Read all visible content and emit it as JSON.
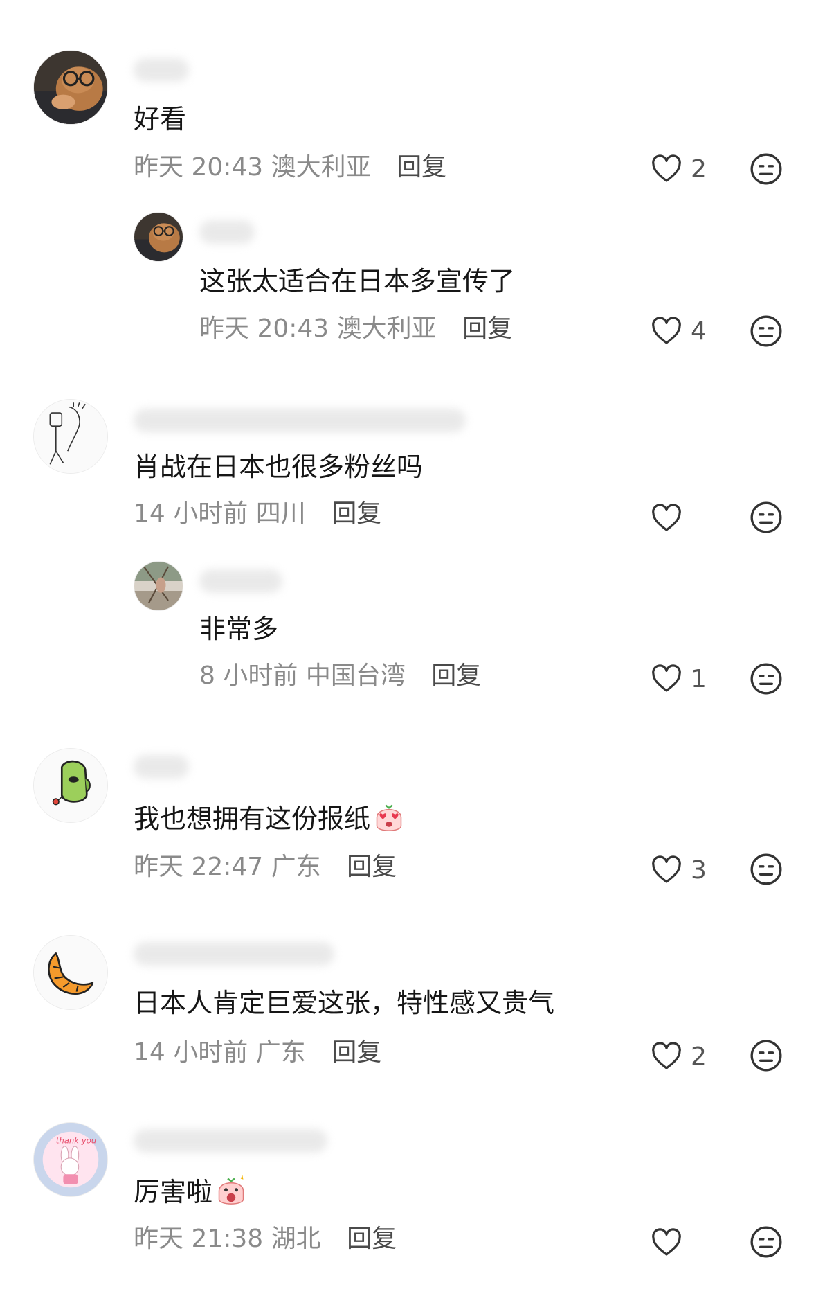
{
  "comments": [
    {
      "text": "好看",
      "time": "昨天 20:43",
      "location": "澳大利亚",
      "reply": "回复",
      "likes": "2",
      "avatar_icon": "cat-with-glasses-icon"
    },
    {
      "text": "这张太适合在日本多宣传了",
      "time": "昨天 20:43",
      "location": "澳大利亚",
      "reply": "回复",
      "likes": "4",
      "avatar_icon": "cat-with-glasses-icon"
    },
    {
      "text": "肖战在日本也很多粉丝吗",
      "time": "14 小时前",
      "location": "四川",
      "reply": "回复",
      "likes": "",
      "avatar_icon": "sketch-figure-icon"
    },
    {
      "text": "非常多",
      "time": "8 小时前",
      "location": "中国台湾",
      "reply": "回复",
      "likes": "1",
      "avatar_icon": "photo-avatar-icon"
    },
    {
      "text": "我也想拥有这份报纸",
      "time": "昨天 22:47",
      "location": "广东",
      "reply": "回复",
      "likes": "3",
      "avatar_icon": "green-bean-icon"
    },
    {
      "text": "日本人肯定巨爱这张，特性感又贵气",
      "time": "14 小时前",
      "location": "广东",
      "reply": "回复",
      "likes": "2",
      "avatar_icon": "croissant-icon"
    },
    {
      "text": "厉害啦",
      "time": "昨天 21:38",
      "location": "湖北",
      "reply": "回复",
      "likes": "",
      "avatar_icon": "bunny-thank-you-icon"
    }
  ],
  "colors": {
    "meta": "#8a8a8a",
    "text": "#161616",
    "icon": "#333333"
  }
}
